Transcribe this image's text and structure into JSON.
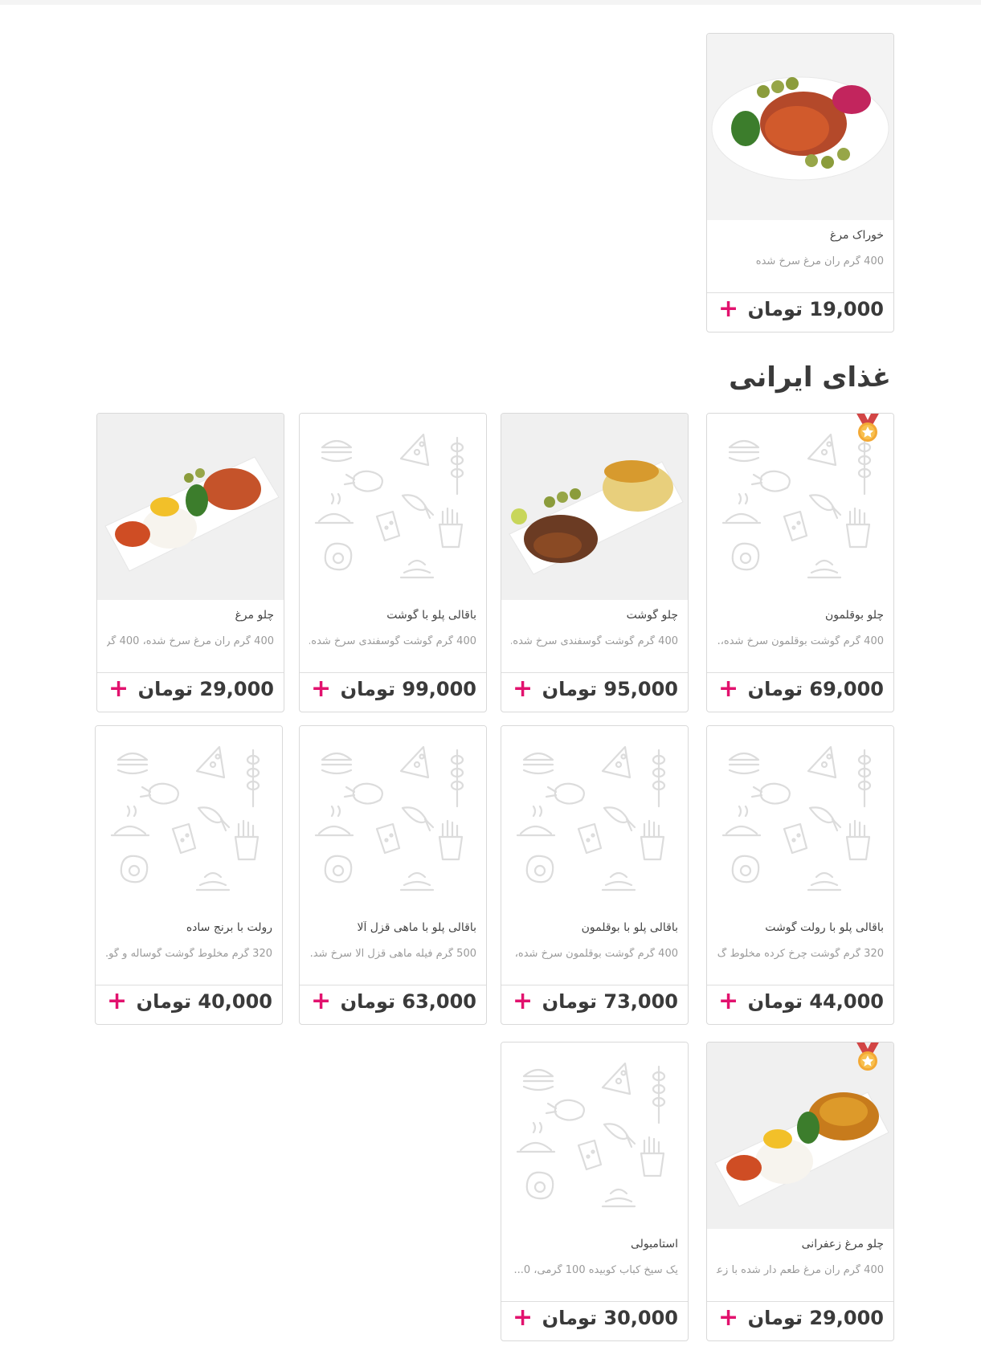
{
  "featured": {
    "name": "خوراک مرغ",
    "desc": "400 گرم ران مرغ سرخ شده",
    "price": "19,000 تومان",
    "add": "+"
  },
  "section": {
    "title": "غذای ایرانی"
  },
  "items": [
    {
      "name": "چلو بوقلمون",
      "desc": "400 گرم گوشت بوقلمون سرخ شده،...",
      "price": "69,000 تومان",
      "add": "+"
    },
    {
      "name": "چلو گوشت",
      "desc": "400 گرم گوشت گوسفندی سرخ شده...",
      "price": "95,000 تومان",
      "add": "+"
    },
    {
      "name": "باقالی پلو با گوشت",
      "desc": "400 گرم گوشت گوسفندی سرخ شده...",
      "price": "99,000 تومان",
      "add": "+"
    },
    {
      "name": "چلو مرغ",
      "desc": "400 گرم ران مرغ سرخ شده، 400 گر...",
      "price": "29,000 تومان",
      "add": "+"
    },
    {
      "name": "باقالی پلو با رولت گوشت",
      "desc": "320 گرم گوشت چرخ کرده مخلوط گ...",
      "price": "44,000 تومان",
      "add": "+"
    },
    {
      "name": "باقالی پلو با بوقلمون",
      "desc": "400 گرم گوشت بوقلمون سرخ شده، ...",
      "price": "73,000 تومان",
      "add": "+"
    },
    {
      "name": "باقالی پلو با ماهی قزل آلا",
      "desc": "500 گرم فیله ماهی قزل آلا سرخ شد...",
      "price": "63,000 تومان",
      "add": "+"
    },
    {
      "name": "رولت با برنج ساده",
      "desc": "320 گرم مخلوط گوشت گوساله و گو...",
      "price": "40,000 تومان",
      "add": "+"
    },
    {
      "name": "چلو مرغ زعفرانی",
      "desc": "400 گرم ران مرغ طعم دار شده با زعف...",
      "price": "29,000 تومان",
      "add": "+"
    },
    {
      "name": "استامبولی",
      "desc": "یک سیخ کباب کوبیده 100 گرمی، 0...",
      "price": "30,000 تومان",
      "add": "+"
    }
  ],
  "colors": {
    "accent": "#e2126e",
    "price": "#3a3a3a",
    "border": "#d9d9d9"
  },
  "icons": [
    "plus-icon",
    "medal-icon",
    "food-pattern"
  ]
}
